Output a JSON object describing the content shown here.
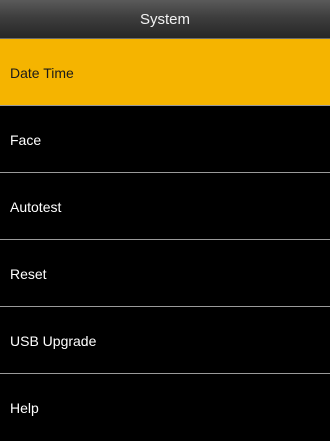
{
  "window": {
    "title": "System"
  },
  "menu": {
    "items": [
      {
        "label": "Date Time",
        "selected": true
      },
      {
        "label": "Face",
        "selected": false
      },
      {
        "label": "Autotest",
        "selected": false
      },
      {
        "label": "Reset",
        "selected": false
      },
      {
        "label": "USB Upgrade",
        "selected": false
      },
      {
        "label": "Help",
        "selected": false
      }
    ]
  },
  "colors": {
    "selected_background": "#f5b400",
    "background": "#000000",
    "text": "#ffffff",
    "divider": "#9a9a9a"
  }
}
